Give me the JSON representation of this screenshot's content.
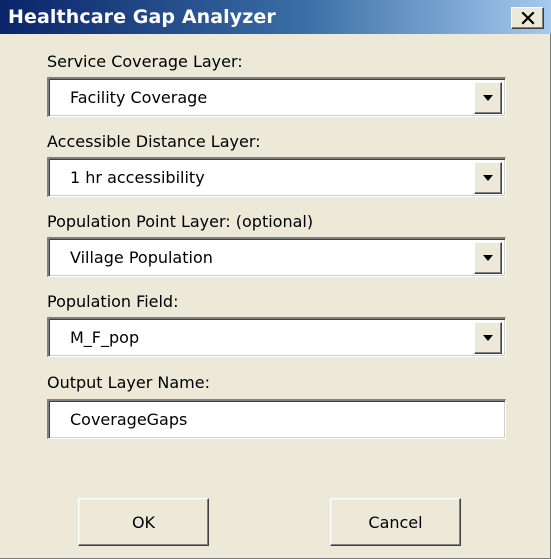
{
  "window": {
    "title": "Healthcare Gap Analyzer",
    "close_icon": "close-icon"
  },
  "fields": {
    "service_coverage": {
      "label": "Service Coverage Layer:",
      "value": "Facility Coverage"
    },
    "accessible_distance": {
      "label": "Accessible Distance Layer:",
      "value": "1 hr accessibility"
    },
    "population_point": {
      "label": "Population Point Layer: (optional)",
      "value": "Village Population"
    },
    "population_field": {
      "label": "Population Field:",
      "value": "M_F_pop"
    },
    "output_layer": {
      "label": "Output Layer Name:",
      "value": "CoverageGaps"
    }
  },
  "buttons": {
    "ok_label": "OK",
    "cancel_label": "Cancel"
  },
  "colors": {
    "title_bar_start": "#0a246a",
    "title_bar_end": "#a6caf0",
    "dialog_background": "#ece9d8"
  },
  "icons": {
    "dropdown": "chevron-down-icon"
  }
}
